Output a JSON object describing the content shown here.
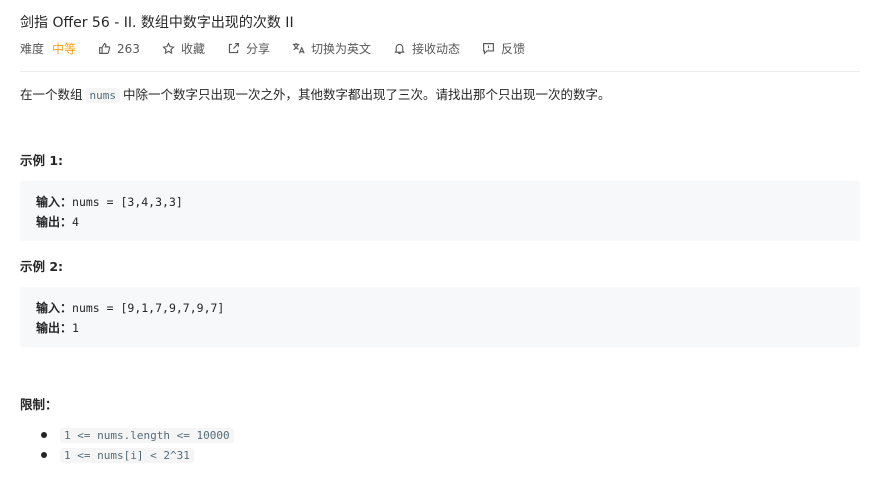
{
  "problem": {
    "title": "剑指 Offer 56 - II. 数组中数字出现的次数 II"
  },
  "meta": {
    "difficulty_label": "难度",
    "difficulty_value": "中等",
    "likes": "263",
    "favorite": "收藏",
    "share": "分享",
    "switch_lang": "切换为英文",
    "subscribe": "接收动态",
    "feedback": "反馈"
  },
  "description": {
    "before": "在一个数组",
    "code": "nums",
    "after": "中除一个数字只出现一次之外，其他数字都出现了三次。请找出那个只出现一次的数字。"
  },
  "examples": [
    {
      "label": "示例 1:",
      "input_key": "输入：",
      "input_value": "nums = [3,4,3,3]",
      "output_key": "输出：",
      "output_value": "4"
    },
    {
      "label": "示例 2:",
      "input_key": "输入：",
      "input_value": "nums = [9,1,7,9,7,9,7]",
      "output_key": "输出：",
      "output_value": "1"
    }
  ],
  "constraints": {
    "label": "限制：",
    "items": [
      "1 <= nums.length <= 10000",
      "1 <= nums[i] < 2^31"
    ]
  },
  "colors": {
    "difficulty_medium": "#ffa116",
    "code_bg": "#f5f5f5",
    "example_bg": "#f7f8fa"
  }
}
